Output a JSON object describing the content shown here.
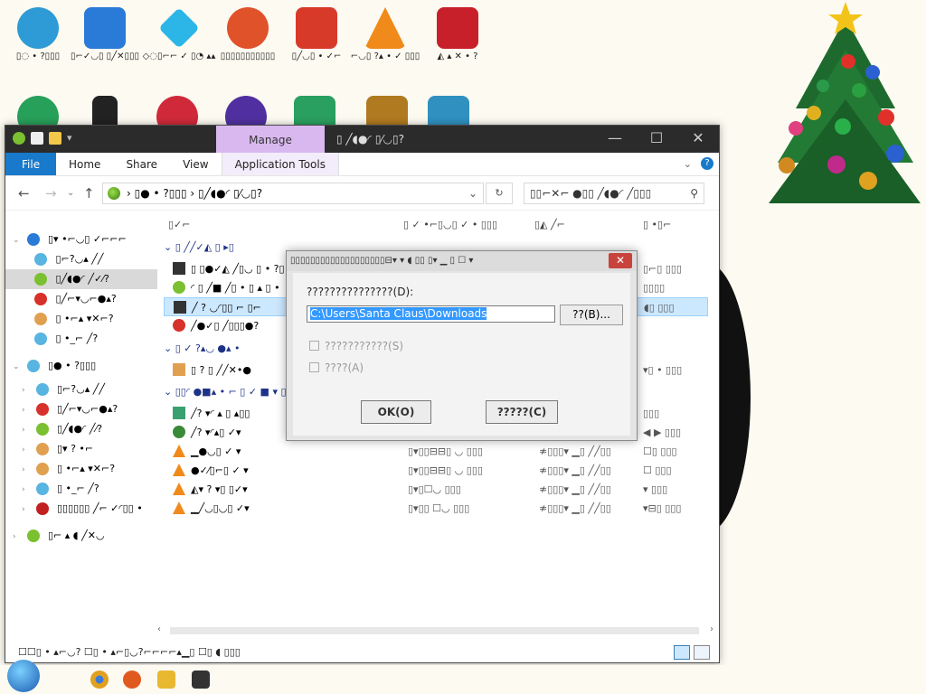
{
  "desktop": {
    "icons": [
      {
        "label": "▯◌ • ?▯▯▯",
        "color": "#2f9bd6"
      },
      {
        "label": "▯⌐✓◡▯ ▯╱✕▯▯▯",
        "color": "#2a7ad8"
      },
      {
        "label": "◇◌▯⌐⌐ ✓ ▯◔ ▴▴",
        "color": "#2cb6e8"
      },
      {
        "label": "▯▯▯▯▯▯▯▯▯▯▯",
        "color": "#e0522a"
      },
      {
        "label": "▯╱◡▯ • ✓⌐",
        "color": "#d83a2a"
      },
      {
        "label": "⌐◡▯ ?▴ • ✓ ▯▯▯",
        "color": "#f08a1a"
      },
      {
        "label": "◭ ▴ ✕ • ?",
        "color": "#c8202a"
      }
    ],
    "row2_colors": [
      "#27a05a",
      "#222222",
      "#d02a3a",
      "#5030a0",
      "#2aa060",
      "#b07a20",
      "#3090c0"
    ]
  },
  "window": {
    "manage_tab": "Manage",
    "title": "▯ ╱◖●◜ ▯⁄◡▯?",
    "buttons": {
      "minimize": "—",
      "maximize": "☐",
      "close": "✕"
    },
    "ribbon_tabs": [
      "File",
      "Home",
      "Share",
      "View",
      "Application Tools"
    ],
    "address": "› ▯●  • ?▯▯▯  › ▯╱◖●◜ ▯⁄◡▯?",
    "search_placeholder": "▯▯⌐✕⌐ ●▯▯ ╱◖●◜ ╱▯▯▯"
  },
  "nav": {
    "items": [
      {
        "label": "▯▾ •⌐◡▯ ✓⌐⌐⌐",
        "color": "#2a7ad8",
        "arrow": "⌄"
      },
      {
        "label": "▯⌐?◡▴ ╱╱",
        "color": "#58b4e0",
        "arrow": ""
      },
      {
        "label": "▯╱◖●◜ ╱✓⁄?",
        "color": "#7ac030",
        "arrow": ""
      },
      {
        "label": "▯╱⌐▾◡⌐●▴?",
        "color": "#d8302a",
        "arrow": ""
      },
      {
        "label": "▯ •⌐▴ ▾✕⌐?",
        "color": "#e0a050",
        "arrow": ""
      },
      {
        "label": "▯ •_⌐ ╱?",
        "color": "#58b4e0",
        "arrow": ""
      },
      {
        "label": "▯●  • ?▯▯▯",
        "color": "#58b4e0",
        "arrow": "⌄"
      },
      {
        "label": "▯⌐?◡▴ ╱╱",
        "color": "#58b4e0",
        "arrow": "›"
      },
      {
        "label": "▯╱⌐▾◡⌐●▴?",
        "color": "#d8302a",
        "arrow": "›"
      },
      {
        "label": "▯╱◖●◜ ╱⁄?",
        "color": "#7ac030",
        "arrow": "›"
      },
      {
        "label": "▯▾ ? •⌐",
        "color": "#e0a050",
        "arrow": "›"
      },
      {
        "label": "▯ •⌐▴ ▾✕⌐?",
        "color": "#e0a050",
        "arrow": "›"
      },
      {
        "label": "▯ •_⌐ ╱?",
        "color": "#58b4e0",
        "arrow": "›"
      },
      {
        "label": "▯▯▯▯▯▯ ╱⌐ ✓◜▯▯ •",
        "color": "#c02020",
        "arrow": "›"
      },
      {
        "label": "▯⌐ ▴ ◖ ╱✕◡",
        "color": "#7ac030",
        "arrow": "›"
      }
    ]
  },
  "filelist": {
    "columns": [
      "▯✓⌐",
      "▯ ✓ •⌐▯◡▯ ✓ • ▯▯▯",
      "▯◭ ╱⌐",
      "▯ •▯⌐"
    ],
    "groups": [
      {
        "label": "▯ ╱╱✓◭ ▯ ▸▯"
      },
      {
        "label": "▯ ✓ ?▴◡ ●▴ •"
      },
      {
        "label": "▯▯◜ ●■▴ • ⌐ ▯ ✓ ■ ▾ ▯"
      }
    ],
    "rows": [
      {
        "name": "▯ ▯●✓◭ ╱▯◡ ▯ • ?▯",
        "date": "▯⌐▯◡ ▯ ▯▯▯",
        "type": "▯▴⌐ ▯⌐ ▯▯▯",
        "size": "▯⌐▯ ▯▯▯",
        "color": "#333333"
      },
      {
        "name": "◜ ▯ ╱■ ╱▯ • ▯ ▴ ▯ •",
        "date": "▯⌐▯◡ ▯ ▯▯▯",
        "type": "▯▯▯▯ ▯",
        "size": "▯▯▯▯",
        "color": "#7ac030"
      },
      {
        "name": "╱ ? ◡◜▯▯ ⌐ ▯⌐",
        "date": "▯▯▯▯",
        "type": "▯▯▯▯",
        "size": "◖▯ ▯▯▯",
        "color": "#333333",
        "selected": true
      },
      {
        "name": "╱●✓▯ ╱▯▯▯●?",
        "date": "",
        "type": "",
        "size": "",
        "color": "#d8302a"
      },
      {
        "name": "▯ ? ▯ ╱╱✕•●",
        "date": "▯▯▯▯ ▯ ▯▯▯",
        "type": "▾▯▯ ● ▯ ▴",
        "size": "▾▯ • ▯▯▯",
        "color": "#e0a050"
      },
      {
        "name": "╱? ▾◜ ▴ ▯ ▴▯▯",
        "date": "▯ ▯▯ ▯▯▯",
        "type": "▯▯▯ • ▯ ◜",
        "size": "▯▯▯",
        "color": "#3aa070"
      },
      {
        "name": "╱? ▾◜▴▯ ✓▾",
        "date": "▯ ▯▯▯",
        "type": "▯⌐ ◜ ▯ ▯▯▯",
        "size": "◀ ▶ ▯▯▯",
        "color": "#3a8a3a"
      },
      {
        "name": "▁●◡▯ ✓ ▾",
        "date": "▯▾▯▯⊟⊟▯ ◡ ▯▯▯",
        "type": "≉▯▯▯▾ ▁▯ ╱╱▯▯",
        "size": "☐▯ ▯▯▯",
        "color": "#f08a1a"
      },
      {
        "name": "●✓⁄▯⌐▯ ✓ ▾",
        "date": "▯▾▯▯⊟⊟▯ ◡ ▯▯▯",
        "type": "≉▯▯▯▾ ▁▯ ╱╱▯▯",
        "size": "☐ ▯▯▯",
        "color": "#f08a1a"
      },
      {
        "name": "◭▾ ? ▾▯ ▯✓▾",
        "date": "▯▾▯☐◡ ▯▯▯",
        "type": "≉▯▯▯▾ ▁▯ ╱╱▯▯",
        "size": "▾ ▯▯▯",
        "color": "#f08a1a"
      },
      {
        "name": "▁╱◡▯◡▯ ✓▾",
        "date": "▯▾▯▯ ☐◡ ▯▯▯",
        "type": "≉▯▯▯▾ ▁▯ ╱╱▯▯",
        "size": "▾⊟▯ ▯▯▯",
        "color": "#f08a1a"
      }
    ]
  },
  "statusbar": {
    "text": "☐☐▯ • ▴⌐◡?    ☐▯ • ▴⌐▯◡?⌐⌐⌐⌐▴▁▯ ☐▯ ◖ ▯▯▯"
  },
  "dialog": {
    "title": "▯▯▯▯▯▯▯▯▯▯▯▯▯▯▯▯▯▯▯⊟▾ ▾ ◖ ▯▯ ▯▾ ▁ ▯ ☐ ▾",
    "close": "✕",
    "label": "???????????????(D):",
    "path": "C:\\Users\\Santa Claus\\Downloads",
    "browse": "??(B)...",
    "checkbox1": "???????????(S)",
    "checkbox2": "????(A)",
    "ok": "OK(O)",
    "cancel": "?????(C)"
  },
  "taskbar": {
    "icons": [
      {
        "name": "chrome-icon",
        "color": "#e0a020"
      },
      {
        "name": "firefox-icon",
        "color": "#e05a20"
      },
      {
        "name": "explorer-icon",
        "color": "#e8b830"
      },
      {
        "name": "app-icon",
        "color": "#333333"
      }
    ]
  }
}
